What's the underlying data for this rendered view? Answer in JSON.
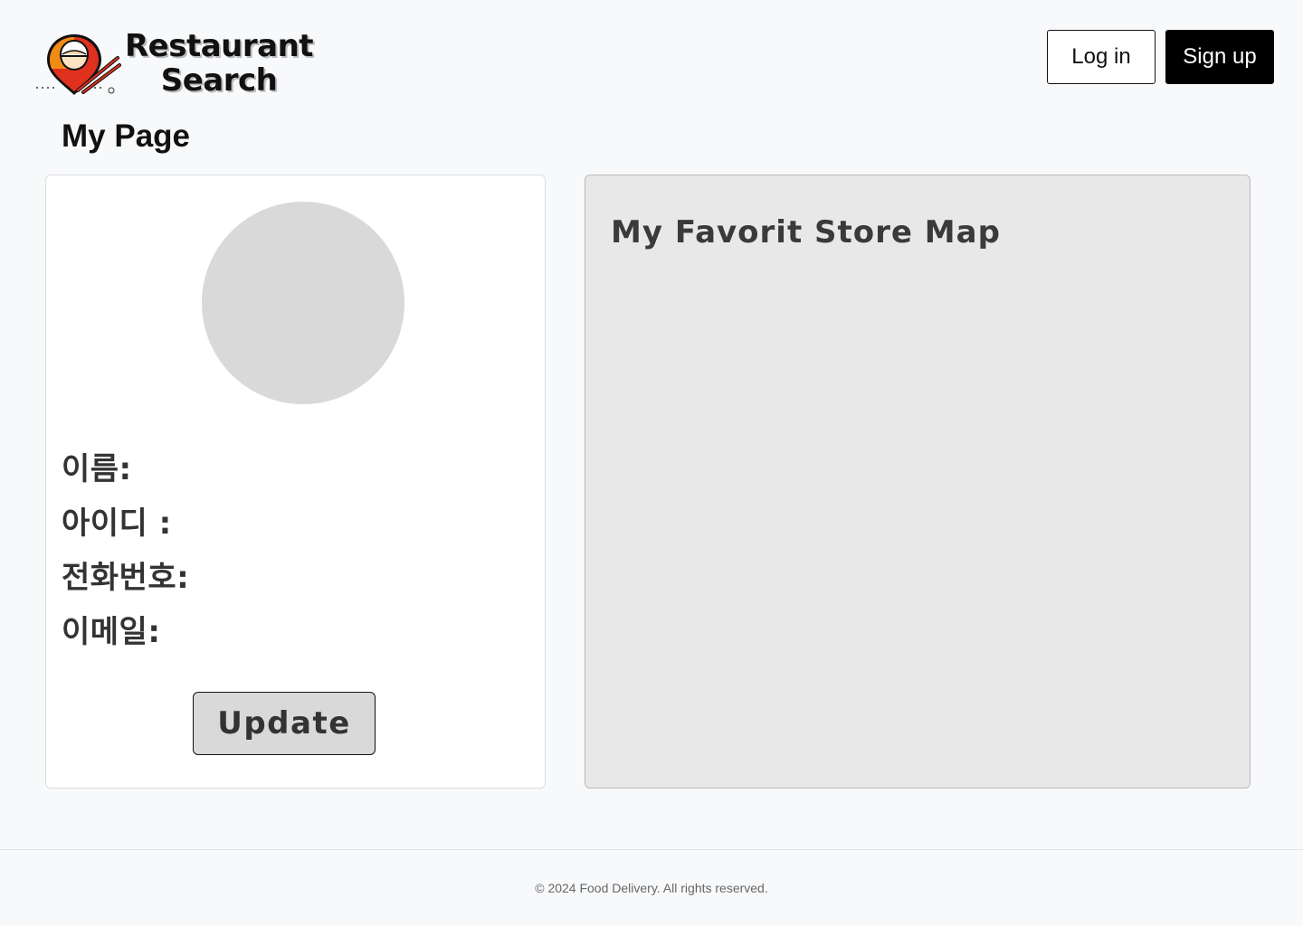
{
  "header": {
    "logo": {
      "line1": "Restaurant",
      "line2": "Search",
      "icon": "bowl-chopsticks-pin-icon"
    },
    "login_label": "Log in",
    "signup_label": "Sign up"
  },
  "main": {
    "page_title": "My Page",
    "profile": {
      "name_label": "이름:",
      "id_label": "아이디 :",
      "phone_label": "전화번호:",
      "email_label": "이메일:",
      "update_label": "Update"
    },
    "map": {
      "title": "My Favorit Store Map"
    }
  },
  "footer": {
    "text": "© 2024 Food Delivery. All rights reserved."
  },
  "colors": {
    "page_bg": "#f8f9fb",
    "signup_bg": "#000000",
    "avatar_bg": "#d9d9d9",
    "map_bg": "#e8e8e8",
    "logo_red": "#e0301e",
    "logo_orange": "#f39c12"
  }
}
